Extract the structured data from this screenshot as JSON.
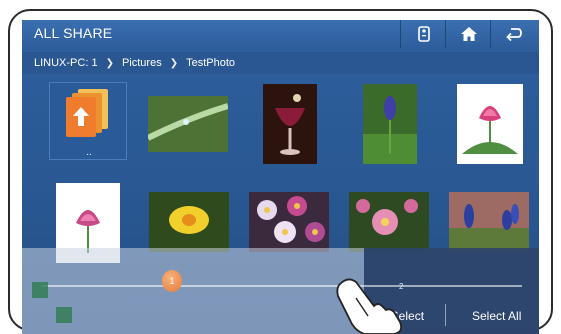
{
  "app": {
    "title": "ALL SHARE"
  },
  "toolbar": {
    "buttons": [
      {
        "icon": "remote-icon"
      },
      {
        "icon": "home-icon"
      },
      {
        "icon": "back-icon"
      }
    ]
  },
  "breadcrumb": {
    "items": [
      "LINUX-PC: 1",
      "Pictures",
      "TestPhoto"
    ],
    "separator": "❯"
  },
  "grid": {
    "folder": {
      "icon": "folder-up-icon",
      "label": ".."
    },
    "photos": [
      "water-droplet-stem",
      "red-wine-glass",
      "grape-hyacinth",
      "pink-lotus",
      "pink-lotus-white",
      "yellow-daffodil",
      "daisy-cluster",
      "pink-flowers-garden",
      "blue-grape-hyacinths"
    ]
  },
  "footer": {
    "slider_page": "1",
    "page_count": "2",
    "multi_select_label": "Multi Select",
    "select_all_label": "Select All"
  },
  "colors": {
    "accent": "#2f5f9e",
    "slider_knob": "#e57a3a"
  }
}
